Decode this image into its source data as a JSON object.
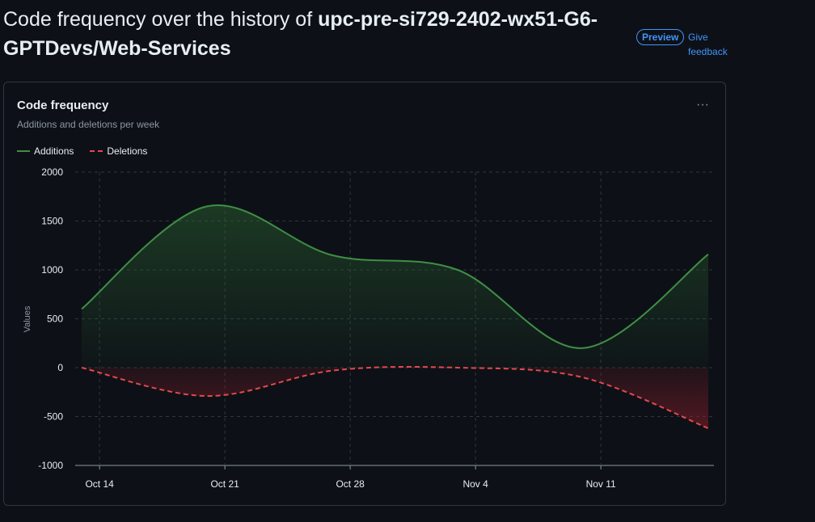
{
  "header": {
    "title_prefix": "Code frequency over the history of ",
    "repo_name": "upc-pre-si729-2402-wx51-G6-GPTDevs/Web-Services",
    "preview_label": "Preview",
    "feedback_label": "Give feedback"
  },
  "card": {
    "title": "Code frequency",
    "subtitle": "Additions and deletions per week",
    "menu_icon": "kebab-horizontal-icon",
    "menu_glyph": "···"
  },
  "colors": {
    "additions": "#3f8f45",
    "deletions": "#e5484d",
    "grid": "#30363d",
    "link": "#4493f8"
  },
  "chart_data": {
    "type": "area",
    "ylabel": "Values",
    "xlabel": "",
    "ylim": [
      -1000,
      2000
    ],
    "yticks": [
      2000,
      1500,
      1000,
      500,
      0,
      -500,
      -1000
    ],
    "x_tick_labels": [
      "Oct 14",
      "Oct 21",
      "Oct 28",
      "Nov 4",
      "Nov 11"
    ],
    "x_tick_days": [
      1,
      8,
      15,
      22,
      29
    ],
    "x_range_days": [
      0,
      35
    ],
    "legend_position": "top-left",
    "grid": true,
    "series": [
      {
        "name": "Additions",
        "key": "additions",
        "style": "solid",
        "x_days": [
          0,
          7,
          14,
          21,
          28,
          35
        ],
        "values": [
          600,
          1650,
          1150,
          1000,
          200,
          1160
        ]
      },
      {
        "name": "Deletions",
        "key": "deletions",
        "style": "dashed",
        "x_days": [
          0,
          7,
          14,
          21,
          28,
          35
        ],
        "values": [
          0,
          -290,
          -30,
          0,
          -100,
          -620
        ]
      }
    ]
  }
}
